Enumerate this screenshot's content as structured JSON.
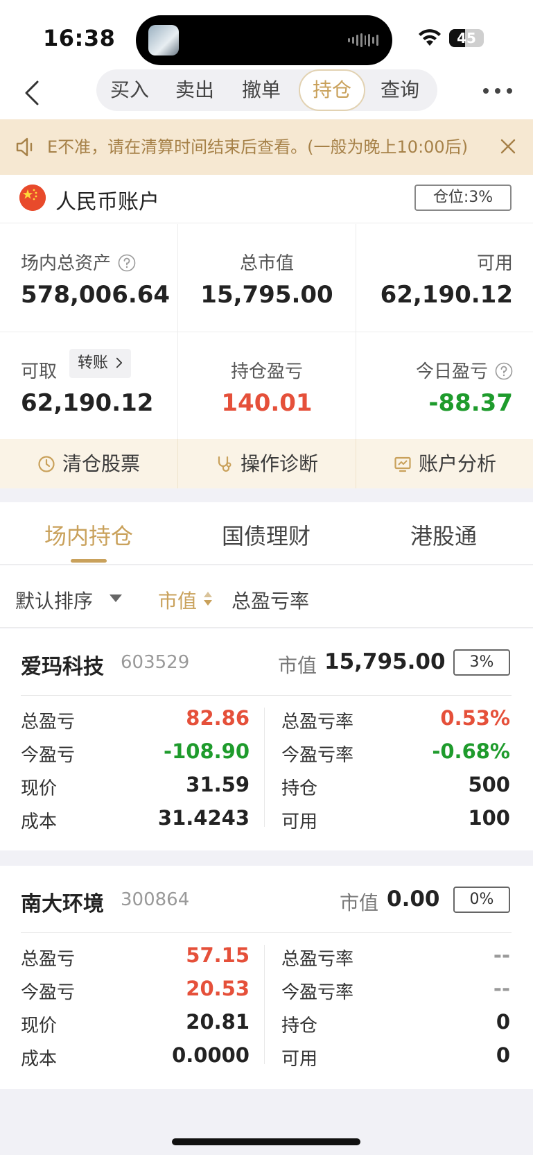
{
  "status_bar": {
    "time": "16:38",
    "battery": "45",
    "battery_level": 0.45
  },
  "nav": {
    "tabs": [
      "买入",
      "卖出",
      "撤单",
      "持仓",
      "查询"
    ],
    "active_tab": 3
  },
  "notice": {
    "text": "E不准，请在清算时间结束后查看。(一般为晚上10:00后)"
  },
  "account": {
    "name": "人民币账户",
    "position_label": "仓位:3%",
    "total_assets_label": "场内总资产",
    "total_assets": "578,006.64",
    "market_value_label": "总市值",
    "market_value": "15,795.00",
    "available_label": "可用",
    "available": "62,190.12",
    "withdrawable_label": "可取",
    "withdrawable": "62,190.12",
    "transfer_label": "转账",
    "holding_pl_label": "持仓盈亏",
    "holding_pl": "140.01",
    "today_pl_label": "今日盈亏",
    "today_pl": "-88.37"
  },
  "actions": {
    "clear": "清仓股票",
    "diagnose": "操作诊断",
    "analysis": "账户分析"
  },
  "holding_tabs": [
    "场内持仓",
    "国债理财",
    "港股通"
  ],
  "sort": {
    "default": "默认排序",
    "market_value": "市值",
    "total_pl_rate": "总盈亏率"
  },
  "labels": {
    "market_value": "市值",
    "total_pl": "总盈亏",
    "today_pl": "今盈亏",
    "price": "现价",
    "cost": "成本",
    "total_pl_rate": "总盈亏率",
    "today_pl_rate": "今盈亏率",
    "holding": "持仓",
    "available": "可用"
  },
  "stocks": [
    {
      "name": "爱玛科技",
      "code": "603529",
      "market_value": "15,795.00",
      "position_pct": "3%",
      "total_pl": "82.86",
      "today_pl": "-108.90",
      "price": "31.59",
      "cost": "31.4243",
      "total_pl_rate": "0.53%",
      "today_pl_rate": "-0.68%",
      "holding": "500",
      "available": "100"
    },
    {
      "name": "南大环境",
      "code": "300864",
      "market_value": "0.00",
      "position_pct": "0%",
      "total_pl": "57.15",
      "today_pl": "20.53",
      "price": "20.81",
      "cost": "0.0000",
      "total_pl_rate": "--",
      "today_pl_rate": "--",
      "holding": "0",
      "available": "0"
    }
  ],
  "colors": {
    "accent": "#c9a15b",
    "up": "#e5503a",
    "down": "#1e9b2c",
    "notice_bg": "#f6e8d2"
  }
}
